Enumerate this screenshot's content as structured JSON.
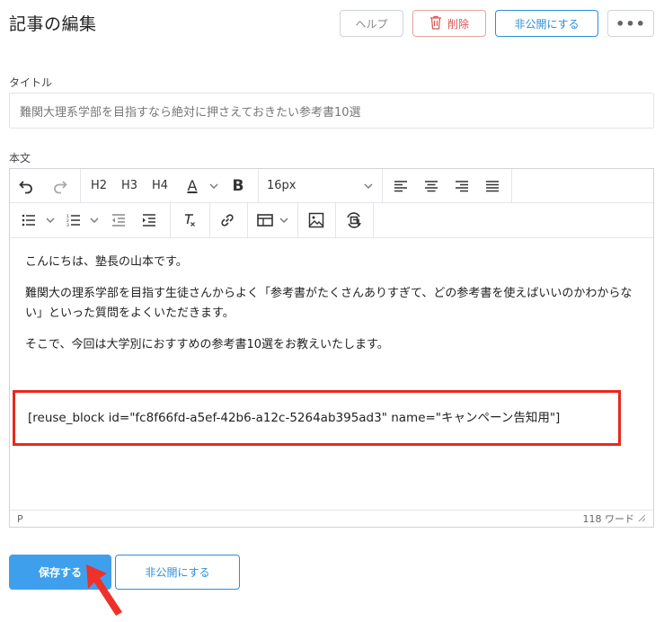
{
  "header": {
    "title": "記事の編集",
    "help_label": "ヘルプ",
    "delete_label": "削除",
    "unpublish_label": "非公開にする",
    "more_label": "•••"
  },
  "title_field": {
    "label": "タイトル",
    "value": "難関大理系学部を目指すなら絶対に押さえておきたい参考書10選"
  },
  "body_field": {
    "label": "本文",
    "toolbar": {
      "h2": "H2",
      "h3": "H3",
      "h4": "H4",
      "font_color": "A",
      "bold": "B",
      "font_size": "16px"
    },
    "paragraphs": [
      "こんにちは、塾長の山本です。",
      "難関大の理系学部を目指す生徒さんからよく「参考書がたくさんありすぎて、どの参考書を使えばいいのかわからない」といった質問をよくいただきます。",
      "そこで、今回は大学別におすすめの参考書10選をお教えいたします。"
    ],
    "shortcode": "[reuse_block id=\"fc8f66fd-a5ef-42b6-a12c-5264ab395ad3\" name=\"キャンペーン告知用\"]",
    "status_path": "P",
    "word_count": "118 ワード"
  },
  "footer": {
    "save_label": "保存する",
    "unpublish_label": "非公開にする"
  },
  "colors": {
    "accent": "#2d8ed8",
    "save_bg": "#3ea0ec",
    "danger": "#d9534f",
    "highlight": "#e8281e"
  }
}
